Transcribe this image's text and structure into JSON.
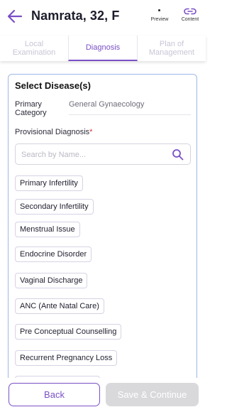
{
  "header": {
    "title": "Namrata, 32, F",
    "back_icon": "arrow-left-icon",
    "actions": [
      {
        "label": "Preview",
        "icon": "preview-icon"
      },
      {
        "label": "Content",
        "icon": "link-icon"
      }
    ]
  },
  "tabs": [
    {
      "label": "Local Examination",
      "active": false
    },
    {
      "label": "Diagnosis",
      "active": true
    },
    {
      "label": "Plan of Management",
      "active": false
    }
  ],
  "form": {
    "title": "Select Disease(s)",
    "primary_category_label": "Primary Category",
    "primary_category_value": "General Gynaecology",
    "provisional_diagnosis_label": "Provisional Diagnosis",
    "required_mark": "*",
    "search_placeholder": "Search by Name...",
    "search_value": "",
    "diseases": [
      "Primary Infertility",
      "Secondary Infertility",
      "Menstrual Issue",
      "Endocrine Disorder",
      "Vaginal Discharge",
      "ANC (Ante Natal Care)",
      "Pre Conceptual Counselling",
      "Recurrent Pregnancy Loss"
    ]
  },
  "footer": {
    "back_label": "Back",
    "save_label": "Save & Continue"
  },
  "colors": {
    "accent": "#7a4fc6",
    "card_border": "#9fb7e6",
    "disabled_button": "#d9d9dc",
    "required": "#d9303f"
  }
}
